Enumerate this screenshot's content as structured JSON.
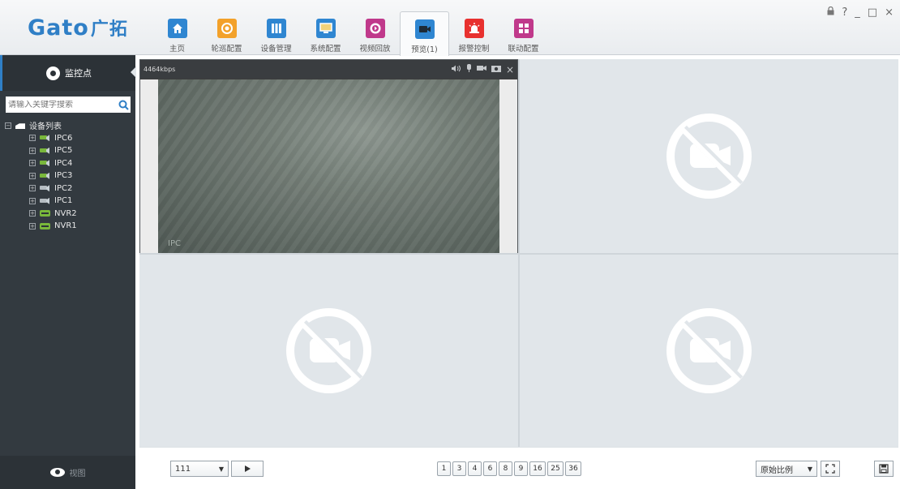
{
  "app": {
    "logo_text": "Gato",
    "logo_cn": "广拓"
  },
  "window_controls": {
    "lock": "🔒",
    "help": "?",
    "minimize": "_",
    "maximize": "□",
    "close": "×"
  },
  "nav": {
    "items": [
      {
        "label": "主页",
        "icon": "home-icon",
        "color": "#2f86d1"
      },
      {
        "label": "轮巡配置",
        "icon": "patrol-icon",
        "color": "#f3a12a"
      },
      {
        "label": "设备管理",
        "icon": "device-icon",
        "color": "#2f86d1"
      },
      {
        "label": "系统配置",
        "icon": "system-icon",
        "color": "#2f86d1"
      },
      {
        "label": "视频回放",
        "icon": "playback-icon",
        "color": "#c0398b"
      },
      {
        "label": "预览(1)",
        "icon": "preview-icon",
        "color": "#2f86d1"
      },
      {
        "label": "报警控制",
        "icon": "alarm-icon",
        "color": "#e8312f"
      },
      {
        "label": "联动配置",
        "icon": "linkage-icon",
        "color": "#c0398b"
      }
    ],
    "active_index": 5
  },
  "sidebar": {
    "title": "监控点",
    "search_placeholder": "请输入关键字搜索",
    "tree_root": "设备列表",
    "devices": [
      {
        "name": "IPC6",
        "type": "ipc",
        "online": true
      },
      {
        "name": "IPC5",
        "type": "ipc",
        "online": true
      },
      {
        "name": "IPC4",
        "type": "ipc",
        "online": true
      },
      {
        "name": "IPC3",
        "type": "ipc",
        "online": true
      },
      {
        "name": "IPC2",
        "type": "ipc",
        "online": false
      },
      {
        "name": "IPC1",
        "type": "ipc",
        "online": false
      },
      {
        "name": "NVR2",
        "type": "nvr",
        "online": true
      },
      {
        "name": "NVR1",
        "type": "nvr",
        "online": true
      }
    ],
    "footer_label": "视图"
  },
  "video": {
    "bitrate": "4464kbps",
    "osd_text": "IPC"
  },
  "toolbar": {
    "group_select": "111",
    "page_layouts": [
      "1",
      "3",
      "4",
      "6",
      "8",
      "9",
      "16",
      "25",
      "36"
    ],
    "ratio_select": "原始比例"
  }
}
